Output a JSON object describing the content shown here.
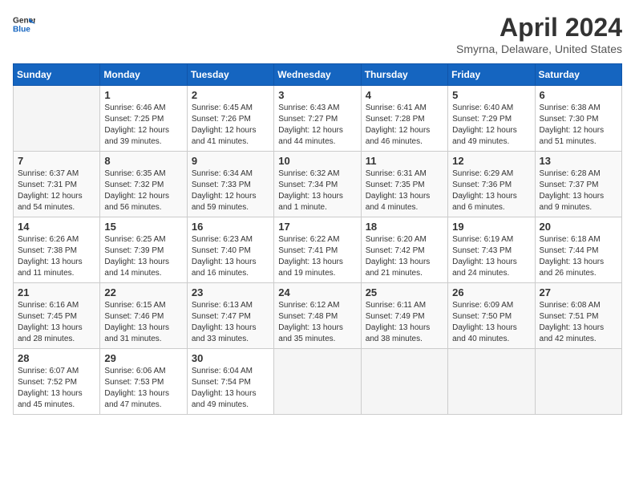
{
  "header": {
    "logo_general": "General",
    "logo_blue": "Blue",
    "month": "April 2024",
    "location": "Smyrna, Delaware, United States"
  },
  "weekdays": [
    "Sunday",
    "Monday",
    "Tuesday",
    "Wednesday",
    "Thursday",
    "Friday",
    "Saturday"
  ],
  "weeks": [
    [
      {
        "day": "",
        "info": ""
      },
      {
        "day": "1",
        "info": "Sunrise: 6:46 AM\nSunset: 7:25 PM\nDaylight: 12 hours\nand 39 minutes."
      },
      {
        "day": "2",
        "info": "Sunrise: 6:45 AM\nSunset: 7:26 PM\nDaylight: 12 hours\nand 41 minutes."
      },
      {
        "day": "3",
        "info": "Sunrise: 6:43 AM\nSunset: 7:27 PM\nDaylight: 12 hours\nand 44 minutes."
      },
      {
        "day": "4",
        "info": "Sunrise: 6:41 AM\nSunset: 7:28 PM\nDaylight: 12 hours\nand 46 minutes."
      },
      {
        "day": "5",
        "info": "Sunrise: 6:40 AM\nSunset: 7:29 PM\nDaylight: 12 hours\nand 49 minutes."
      },
      {
        "day": "6",
        "info": "Sunrise: 6:38 AM\nSunset: 7:30 PM\nDaylight: 12 hours\nand 51 minutes."
      }
    ],
    [
      {
        "day": "7",
        "info": "Sunrise: 6:37 AM\nSunset: 7:31 PM\nDaylight: 12 hours\nand 54 minutes."
      },
      {
        "day": "8",
        "info": "Sunrise: 6:35 AM\nSunset: 7:32 PM\nDaylight: 12 hours\nand 56 minutes."
      },
      {
        "day": "9",
        "info": "Sunrise: 6:34 AM\nSunset: 7:33 PM\nDaylight: 12 hours\nand 59 minutes."
      },
      {
        "day": "10",
        "info": "Sunrise: 6:32 AM\nSunset: 7:34 PM\nDaylight: 13 hours\nand 1 minute."
      },
      {
        "day": "11",
        "info": "Sunrise: 6:31 AM\nSunset: 7:35 PM\nDaylight: 13 hours\nand 4 minutes."
      },
      {
        "day": "12",
        "info": "Sunrise: 6:29 AM\nSunset: 7:36 PM\nDaylight: 13 hours\nand 6 minutes."
      },
      {
        "day": "13",
        "info": "Sunrise: 6:28 AM\nSunset: 7:37 PM\nDaylight: 13 hours\nand 9 minutes."
      }
    ],
    [
      {
        "day": "14",
        "info": "Sunrise: 6:26 AM\nSunset: 7:38 PM\nDaylight: 13 hours\nand 11 minutes."
      },
      {
        "day": "15",
        "info": "Sunrise: 6:25 AM\nSunset: 7:39 PM\nDaylight: 13 hours\nand 14 minutes."
      },
      {
        "day": "16",
        "info": "Sunrise: 6:23 AM\nSunset: 7:40 PM\nDaylight: 13 hours\nand 16 minutes."
      },
      {
        "day": "17",
        "info": "Sunrise: 6:22 AM\nSunset: 7:41 PM\nDaylight: 13 hours\nand 19 minutes."
      },
      {
        "day": "18",
        "info": "Sunrise: 6:20 AM\nSunset: 7:42 PM\nDaylight: 13 hours\nand 21 minutes."
      },
      {
        "day": "19",
        "info": "Sunrise: 6:19 AM\nSunset: 7:43 PM\nDaylight: 13 hours\nand 24 minutes."
      },
      {
        "day": "20",
        "info": "Sunrise: 6:18 AM\nSunset: 7:44 PM\nDaylight: 13 hours\nand 26 minutes."
      }
    ],
    [
      {
        "day": "21",
        "info": "Sunrise: 6:16 AM\nSunset: 7:45 PM\nDaylight: 13 hours\nand 28 minutes."
      },
      {
        "day": "22",
        "info": "Sunrise: 6:15 AM\nSunset: 7:46 PM\nDaylight: 13 hours\nand 31 minutes."
      },
      {
        "day": "23",
        "info": "Sunrise: 6:13 AM\nSunset: 7:47 PM\nDaylight: 13 hours\nand 33 minutes."
      },
      {
        "day": "24",
        "info": "Sunrise: 6:12 AM\nSunset: 7:48 PM\nDaylight: 13 hours\nand 35 minutes."
      },
      {
        "day": "25",
        "info": "Sunrise: 6:11 AM\nSunset: 7:49 PM\nDaylight: 13 hours\nand 38 minutes."
      },
      {
        "day": "26",
        "info": "Sunrise: 6:09 AM\nSunset: 7:50 PM\nDaylight: 13 hours\nand 40 minutes."
      },
      {
        "day": "27",
        "info": "Sunrise: 6:08 AM\nSunset: 7:51 PM\nDaylight: 13 hours\nand 42 minutes."
      }
    ],
    [
      {
        "day": "28",
        "info": "Sunrise: 6:07 AM\nSunset: 7:52 PM\nDaylight: 13 hours\nand 45 minutes."
      },
      {
        "day": "29",
        "info": "Sunrise: 6:06 AM\nSunset: 7:53 PM\nDaylight: 13 hours\nand 47 minutes."
      },
      {
        "day": "30",
        "info": "Sunrise: 6:04 AM\nSunset: 7:54 PM\nDaylight: 13 hours\nand 49 minutes."
      },
      {
        "day": "",
        "info": ""
      },
      {
        "day": "",
        "info": ""
      },
      {
        "day": "",
        "info": ""
      },
      {
        "day": "",
        "info": ""
      }
    ]
  ]
}
